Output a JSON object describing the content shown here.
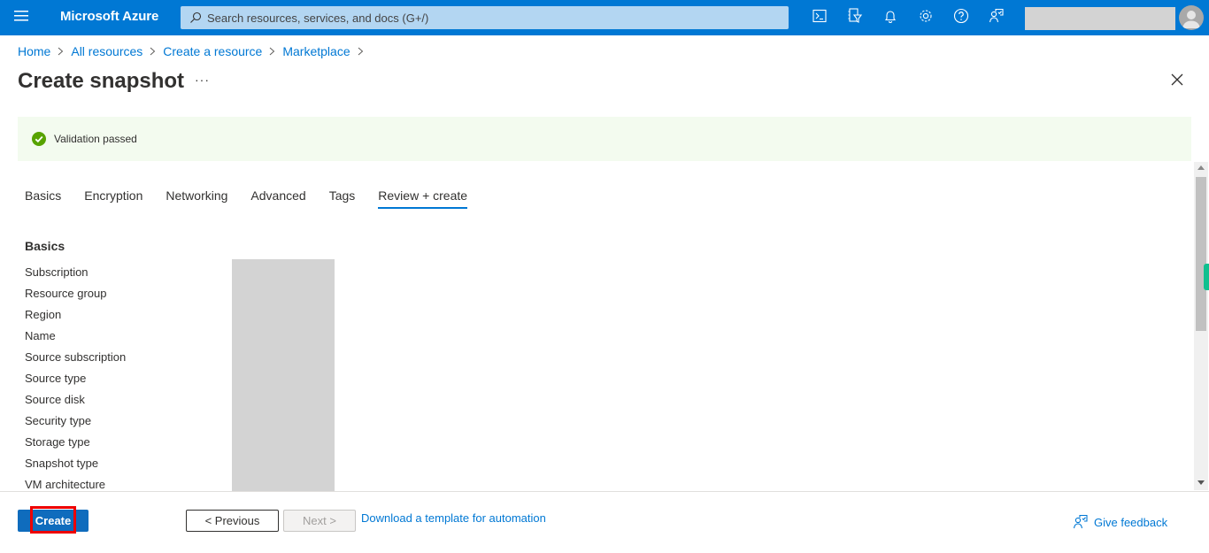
{
  "topbar": {
    "brand": "Microsoft Azure",
    "search_placeholder": "Search resources, services, and docs (G+/)",
    "icons": [
      "cloud-shell-icon",
      "directory-filter-icon",
      "notifications-icon",
      "settings-icon",
      "help-icon",
      "feedback-icon"
    ],
    "colors": {
      "bar": "#0078d4",
      "search": "#b3d6f2"
    }
  },
  "breadcrumb": [
    {
      "label": "Home"
    },
    {
      "label": "All resources"
    },
    {
      "label": "Create a resource"
    },
    {
      "label": "Marketplace"
    }
  ],
  "page": {
    "title": "Create snapshot",
    "more": "···"
  },
  "banner": {
    "status": "success",
    "text": "Validation passed",
    "colors": {
      "background": "#f3fbef",
      "icon": "#57a300"
    }
  },
  "tabs": [
    {
      "label": "Basics",
      "active": false
    },
    {
      "label": "Encryption",
      "active": false
    },
    {
      "label": "Networking",
      "active": false
    },
    {
      "label": "Advanced",
      "active": false
    },
    {
      "label": "Tags",
      "active": false
    },
    {
      "label": "Review + create",
      "active": true
    }
  ],
  "review": {
    "section_title": "Basics",
    "fields": [
      {
        "label": "Subscription",
        "value": ""
      },
      {
        "label": "Resource group",
        "value": ""
      },
      {
        "label": "Region",
        "value": ""
      },
      {
        "label": "Name",
        "value": ""
      },
      {
        "label": "Source subscription",
        "value": ""
      },
      {
        "label": "Source type",
        "value": ""
      },
      {
        "label": "Source disk",
        "value": ""
      },
      {
        "label": "Security type",
        "value": ""
      },
      {
        "label": "Storage type",
        "value": ""
      },
      {
        "label": "Snapshot type",
        "value": ""
      },
      {
        "label": "VM architecture",
        "value": ""
      }
    ]
  },
  "footer": {
    "create_label": "Create",
    "previous_label": "< Previous",
    "next_label": "Next >",
    "next_disabled": true,
    "template_link": "Download a template for automation",
    "feedback_label": "Give feedback",
    "colors": {
      "primary": "#0f6cbd",
      "highlight": "#ee0000",
      "link": "#0078d4"
    }
  }
}
